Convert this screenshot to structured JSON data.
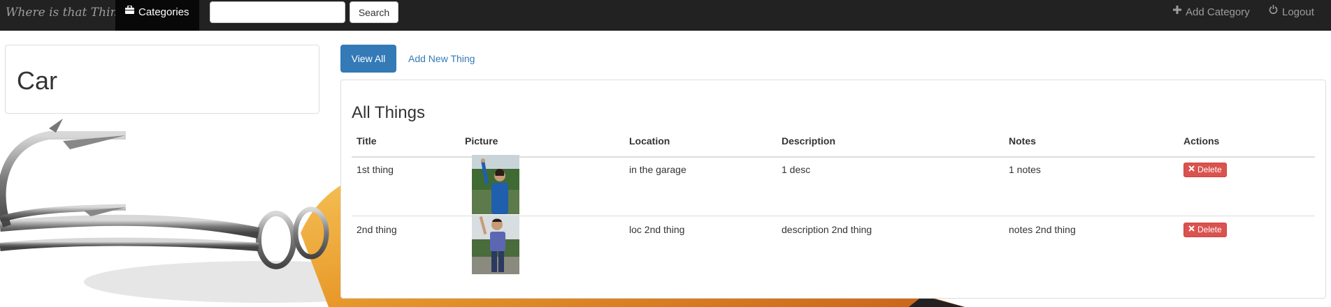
{
  "navbar": {
    "brand": "Where is that Thing?",
    "categories_label": "Categories",
    "search_placeholder": "",
    "search_button": "Search",
    "add_category_label": "Add Category",
    "logout_label": "Logout"
  },
  "category": {
    "title": "Car"
  },
  "tabs": {
    "view_all": "View All",
    "add_new": "Add New Thing"
  },
  "things": {
    "title": "All Things",
    "columns": [
      "Title",
      "Picture",
      "Location",
      "Description",
      "Notes",
      "Actions"
    ],
    "rows": [
      {
        "title": "1st thing",
        "location": "in the garage",
        "description": "1 desc",
        "notes": "1 notes",
        "action": "Delete"
      },
      {
        "title": "2nd thing",
        "location": "loc 2nd thing",
        "description": "description 2nd thing",
        "notes": "notes 2nd thing",
        "action": "Delete"
      }
    ]
  },
  "colors": {
    "navbar": "#222222",
    "primary": "#337ab7",
    "danger": "#d9534f"
  },
  "icons": {
    "categories": "briefcase-icon",
    "add": "plus-icon",
    "logout": "power-icon",
    "delete": "remove-icon"
  }
}
